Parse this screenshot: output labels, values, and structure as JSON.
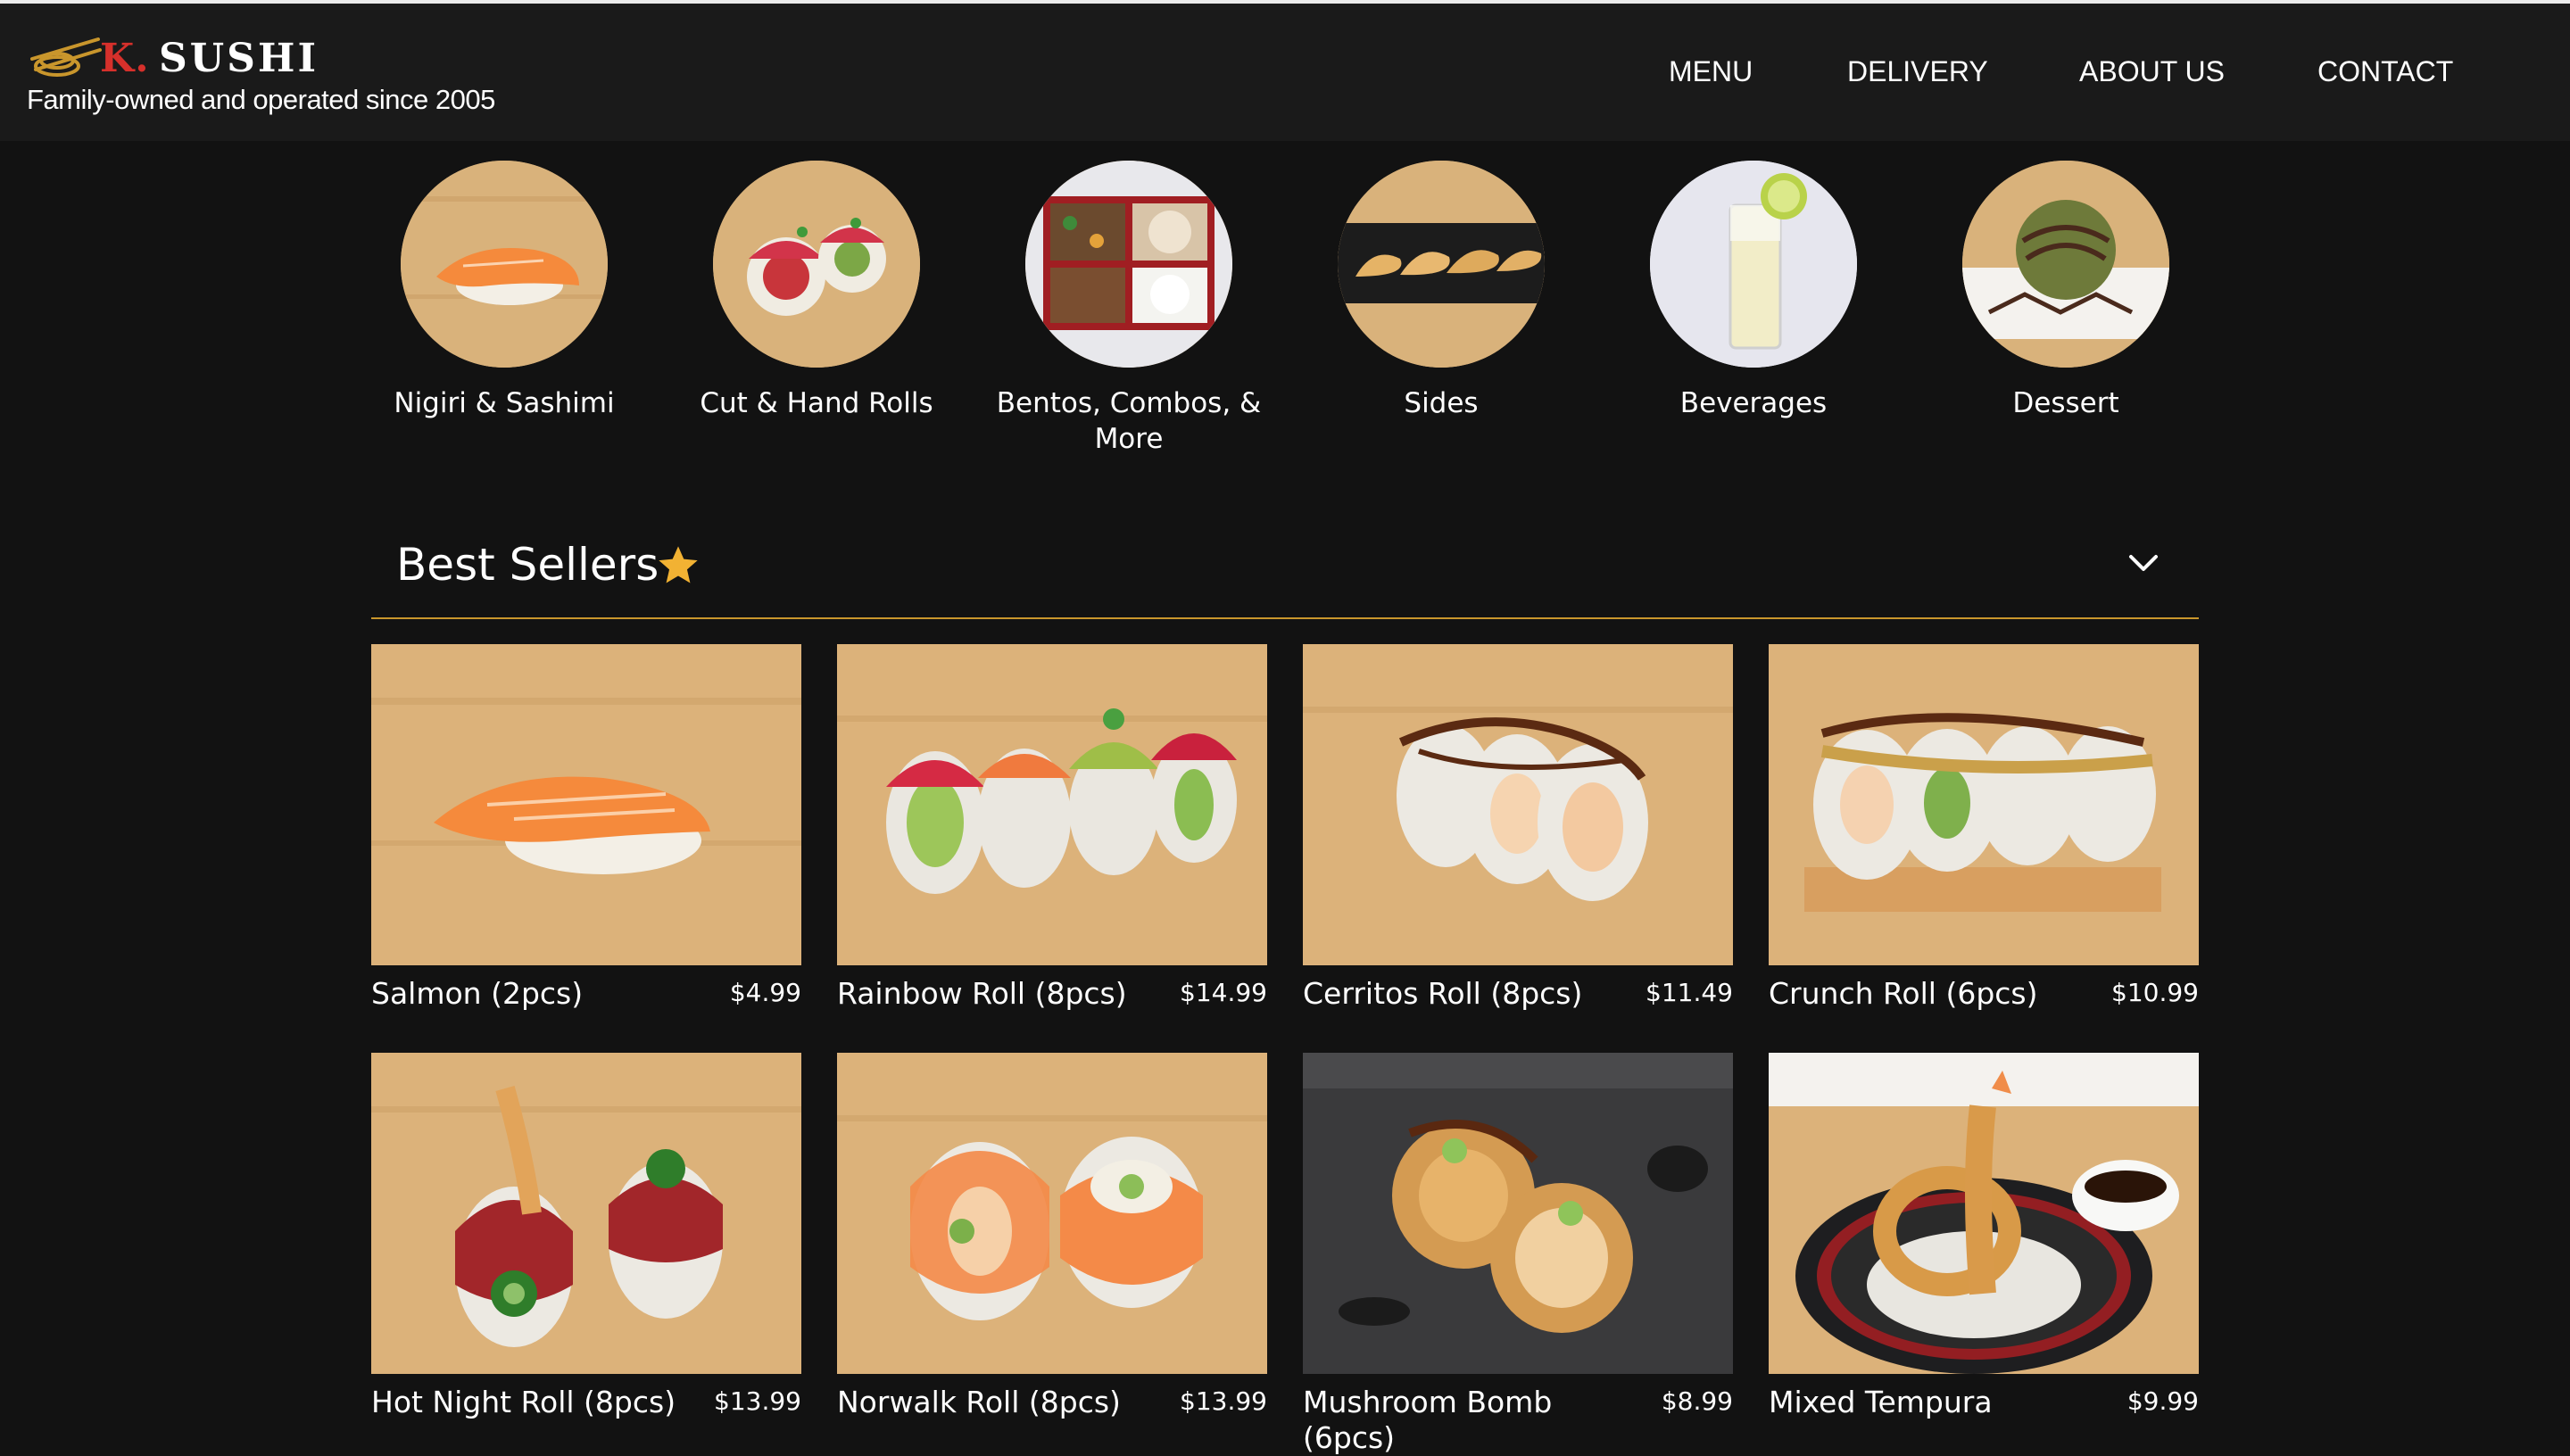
{
  "brand": {
    "initial": "K.",
    "name": "SUSHI",
    "tagline": "Family-owned and operated since 2005",
    "logo_icon": "sushi-chopsticks-icon"
  },
  "nav": {
    "items": [
      "MENU",
      "DELIVERY",
      "ABOUT US",
      "CONTACT"
    ]
  },
  "categories": [
    {
      "label": "Nigiri & Sashimi"
    },
    {
      "label": "Cut & Hand Rolls"
    },
    {
      "label": "Bentos, Combos, & More"
    },
    {
      "label": "Sides"
    },
    {
      "label": "Beverages"
    },
    {
      "label": "Dessert"
    }
  ],
  "section": {
    "title": "Best Sellers",
    "star_icon": "star-icon",
    "toggle_icon": "chevron-down-icon",
    "accent_color": "#c9962c"
  },
  "products": [
    {
      "name": "Salmon (2pcs)",
      "price": "$4.99"
    },
    {
      "name": "Rainbow Roll (8pcs)",
      "price": "$14.99"
    },
    {
      "name": "Cerritos Roll (8pcs)",
      "price": "$11.49"
    },
    {
      "name": "Crunch Roll (6pcs)",
      "price": "$10.99"
    },
    {
      "name": "Hot Night Roll (8pcs)",
      "price": "$13.99"
    },
    {
      "name": "Norwalk Roll (8pcs)",
      "price": "$13.99"
    },
    {
      "name": "Mushroom Bomb (6pcs)",
      "price": "$8.99"
    },
    {
      "name": "Mixed Tempura",
      "price": "$9.99"
    }
  ]
}
